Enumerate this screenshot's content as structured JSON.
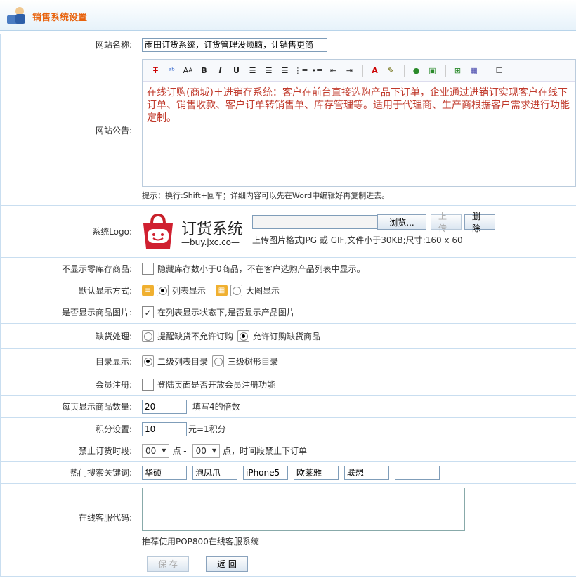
{
  "header": {
    "title": "销售系统设置",
    "icon": "settings-person-icon"
  },
  "site_name": {
    "label": "网站名称:",
    "value": "雨田订货系统，订货管理没烦脑，让销售更简"
  },
  "announcement": {
    "label": "网站公告:",
    "content": "在线订购(商城)＋进销存系统：客户在前台直接选购产品下订单，企业通过进销订实现客户在线下订单、销售收款、客户订单转销售单、库存管理等。适用于代理商、生产商根据客户需求进行功能定制。",
    "hint": "提示：换行:Shift+回车；详细内容可以先在Word中编辑好再复制进去。",
    "toolbar": [
      "T",
      "ABC",
      "A",
      "B",
      "I",
      "U",
      "≡",
      "≡",
      "≡",
      "1.",
      "•",
      "⇤",
      "⇥",
      "A",
      "✎",
      "●",
      "▲",
      "+",
      "▦",
      "☐"
    ]
  },
  "logo": {
    "label": "系统Logo:",
    "brand": "订货系统",
    "url": "—buy.jxc.co—",
    "browse": "浏览...",
    "upload": "上 传",
    "delete": "删 除",
    "hint": "上传图片格式JPG 或  GIF,文件小于30KB;尺寸:160 x 60"
  },
  "hide_zero_stock": {
    "label": "不显示零库存商品:",
    "text": "隐藏库存数小于0商品，不在客户选购产品列表中显示。",
    "checked": false
  },
  "default_display": {
    "label": "默认显示方式:",
    "list": "列表显示",
    "grid": "大图显示",
    "selected": "list"
  },
  "show_image": {
    "label": "是否显示商品图片:",
    "text": "在列表显示状态下,是否显示产品图片",
    "checked": true
  },
  "out_of_stock": {
    "label": "缺货处理:",
    "option1": "提醒缺货不允许订购",
    "option2": "允许订购缺货商品",
    "selected": 2
  },
  "catalog": {
    "label": "目录显示:",
    "option1": "二级列表目录",
    "option2": "三级树形目录",
    "selected": 1
  },
  "member_reg": {
    "label": "会员注册:",
    "text": "登陆页面是否开放会员注册功能",
    "checked": false
  },
  "per_page": {
    "label": "每页显示商品数量:",
    "value": "20",
    "note": "填写4的倍数"
  },
  "points": {
    "label": "积分设置:",
    "value": "10",
    "note": "元=1积分"
  },
  "no_order": {
    "label": "禁止订货时段:",
    "from": "00",
    "sep1": "点 -",
    "to": "00",
    "sep2": "点，时间段禁止下订单"
  },
  "hot_keywords": {
    "label": "热门搜索关键词:",
    "values": [
      "华硕",
      "泡凤爪",
      "iPhone5",
      "欧莱雅",
      "联想",
      ""
    ]
  },
  "service_code": {
    "label": "在线客服代码:",
    "hint": "推荐使用POP800在线客服系统"
  },
  "actions": {
    "save": "保 存",
    "back": "返 回"
  }
}
